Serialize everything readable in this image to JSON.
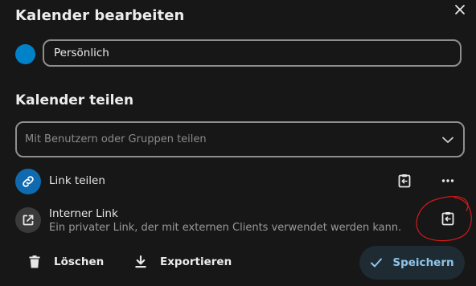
{
  "dialog": {
    "title": "Kalender bearbeiten",
    "close_icon": "close-icon"
  },
  "calendar": {
    "color": "#0082c9",
    "name": "Persönlich"
  },
  "sharing": {
    "title": "Kalender teilen",
    "placeholder": "Mit Benutzern oder Gruppen teilen",
    "share_link": {
      "label": "Link teilen",
      "icon": "link-icon",
      "actions": [
        "clipboard-icon",
        "more-icon"
      ]
    },
    "internal_link": {
      "title": "Interner Link",
      "subtitle": "Ein privater Link, der mit externen Clients verwendet werden kann.",
      "icon": "open-in-new-icon",
      "action": "clipboard-icon"
    }
  },
  "footer": {
    "delete_label": "Löschen",
    "export_label": "Exportieren",
    "save_label": "Speichern"
  },
  "colors": {
    "accent": "#0082c9",
    "save_text": "#8fc4ea",
    "annotation": "#d11a1a"
  }
}
